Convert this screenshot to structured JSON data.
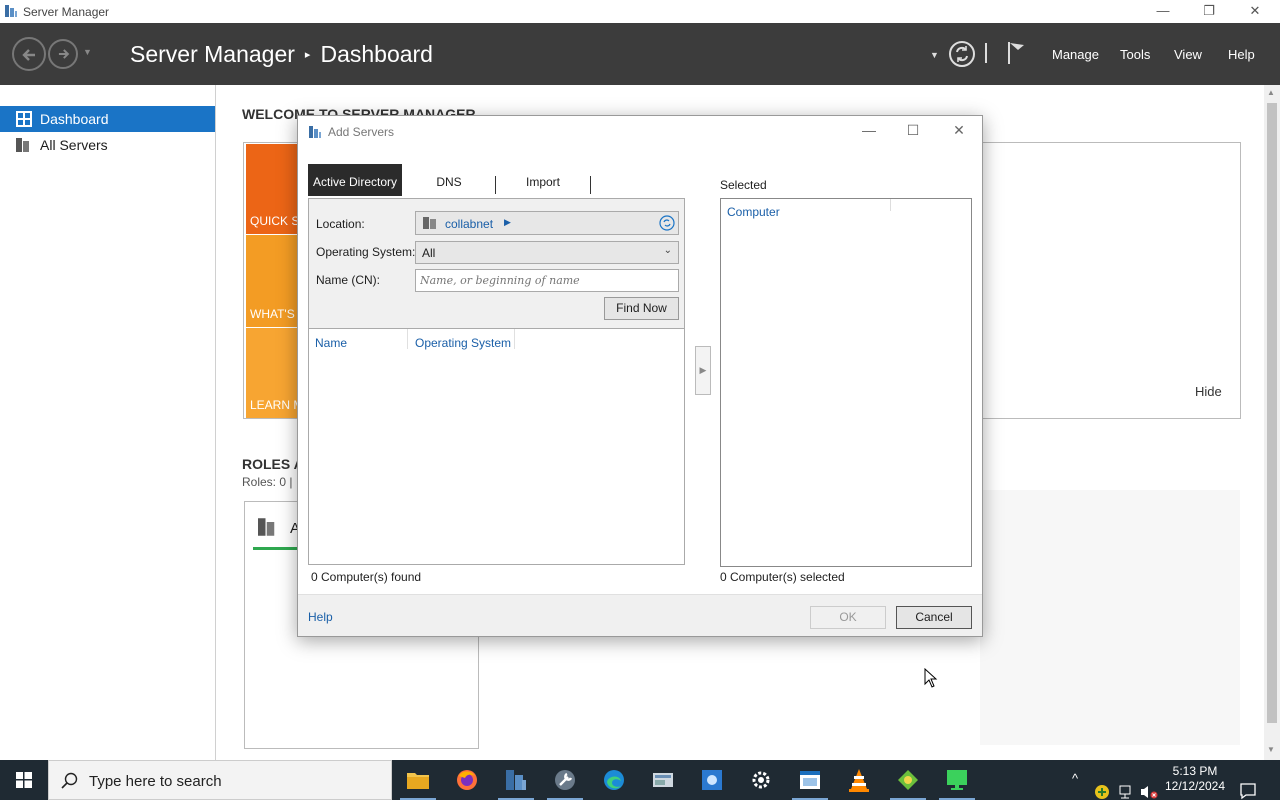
{
  "window": {
    "title": "Server Manager",
    "minimize": "—",
    "restore": "❐",
    "close": "✕"
  },
  "header": {
    "app_name": "Server Manager",
    "separator": "▸",
    "page": "Dashboard",
    "menu": {
      "manage": "Manage",
      "tools": "Tools",
      "view": "View",
      "help": "Help"
    }
  },
  "sidebar": {
    "items": [
      {
        "label": "Dashboard",
        "icon": "dashboard-icon",
        "active": true
      },
      {
        "label": "All Servers",
        "icon": "servers-icon",
        "active": false
      }
    ]
  },
  "main": {
    "welcome_title": "WELCOME TO SERVER MANAGER",
    "tiles": [
      {
        "label": "QUICK START",
        "color": "#ec6516"
      },
      {
        "label": "WHAT'S NEW",
        "color": "#f39c24"
      },
      {
        "label": "LEARN MORE",
        "color": "#f7a532"
      }
    ],
    "hide": "Hide",
    "roles_title": "ROLES AND SERVER GROUPS",
    "roles_sub": "Roles: 0   |",
    "role_card_title": "A"
  },
  "dialog": {
    "title": "Add Servers",
    "tabs": [
      "Active Directory",
      "DNS",
      "Import"
    ],
    "location_label": "Location:",
    "location_value": "collabnet",
    "os_label": "Operating System:",
    "os_value": "All",
    "name_label": "Name (CN):",
    "name_placeholder": "Name, or beginning of name",
    "find_now": "Find Now",
    "col_name": "Name",
    "col_os": "Operating System",
    "found_text": "0 Computer(s) found",
    "selected_label": "Selected",
    "selected_col": "Computer",
    "selected_text": "0 Computer(s) selected",
    "help": "Help",
    "ok": "OK",
    "cancel": "Cancel",
    "move_arrow": "▶"
  },
  "taskbar": {
    "search_placeholder": "Type here to search",
    "time": "5:13 PM",
    "date": "12/12/2024"
  },
  "colors": {
    "accent": "#1a74c6",
    "header_bg": "#3c3c3c",
    "taskbar_bg": "#1f2a33"
  }
}
